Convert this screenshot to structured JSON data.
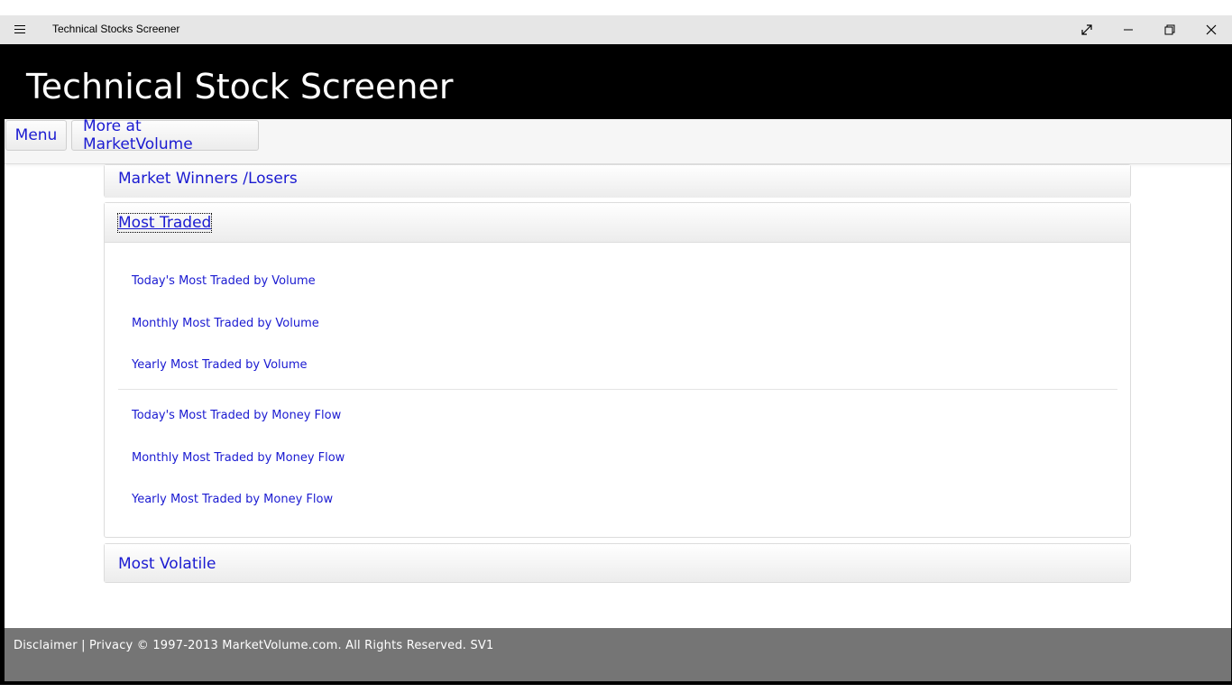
{
  "window": {
    "title": "Technical Stocks Screener",
    "controls": [
      "expand-icon",
      "minimize-icon",
      "restore-icon",
      "close-icon"
    ]
  },
  "app": {
    "title": "Technical Stock Screener"
  },
  "nav": {
    "menu_label": "Menu",
    "more_label": "More at MarketVolume"
  },
  "sections": {
    "winners": {
      "label": "Market Winners /Losers"
    },
    "traded": {
      "label": "Most Traded",
      "volume_links": [
        "Today's Most Traded by Volume",
        "Monthly Most Traded by Volume",
        "Yearly Most Traded by Volume"
      ],
      "money_links": [
        "Today's Most Traded by Money Flow",
        "Monthly Most Traded by Money Flow",
        "Yearly Most Traded by Money Flow"
      ]
    },
    "volatile": {
      "label": "Most Volatile"
    }
  },
  "footer": {
    "text": "Disclaimer | Privacy © 1997-2013 MarketVolume.com. All Rights Reserved. SV1"
  },
  "colors": {
    "link": "#1a1ad1",
    "header_bg": "#000000",
    "footer_bg": "#757575",
    "titlebar_bg": "#e6e6e6"
  }
}
